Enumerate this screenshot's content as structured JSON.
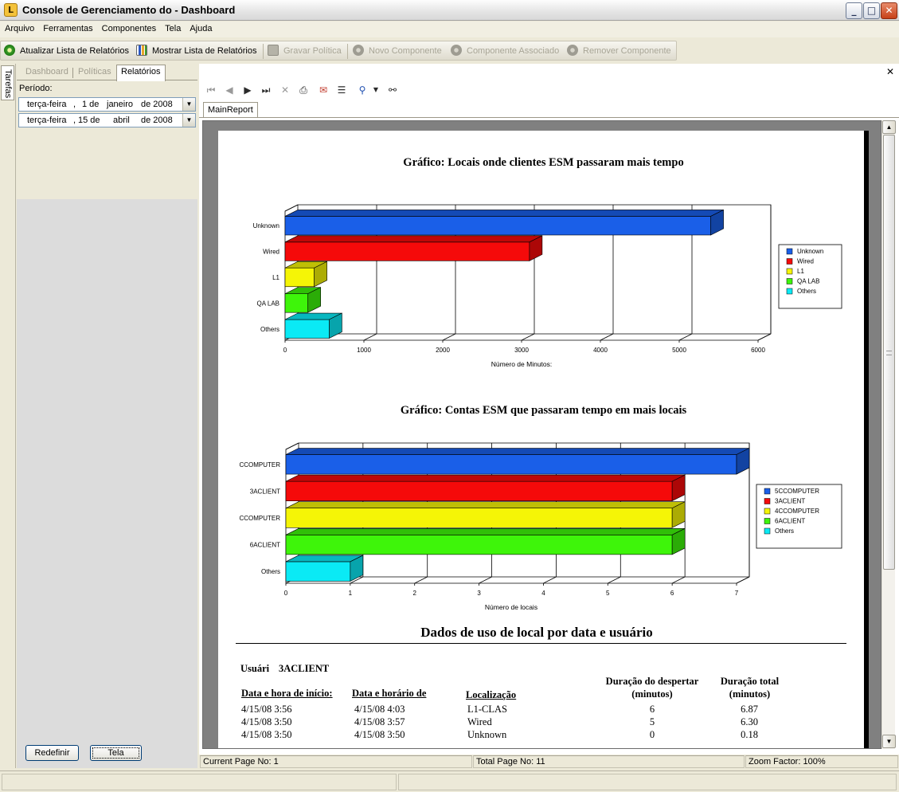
{
  "window": {
    "title": "Console de Gerenciamento do  - Dashboard",
    "app_icon_letter": "L",
    "controls": {
      "minimize": "_",
      "maximize": "□",
      "close": "✕"
    }
  },
  "menu": [
    "Arquivo",
    "Ferramentas",
    "Componentes",
    "Tela",
    "Ajuda"
  ],
  "toolbar": {
    "items": [
      {
        "label": "Atualizar Lista de Relatórios",
        "icon": "refresh-icon",
        "enabled": true
      },
      {
        "label": "Mostrar Lista de Relatórios",
        "icon": "chart-list-icon",
        "enabled": true
      },
      {
        "label": "Gravar Política",
        "icon": "save-disk-icon",
        "enabled": false
      },
      {
        "label": "Novo Componente",
        "icon": "gears-icon",
        "enabled": false
      },
      {
        "label": "Componente Associado",
        "icon": "gears-icon",
        "enabled": false
      },
      {
        "label": "Remover Componente",
        "icon": "gears-icon",
        "enabled": false
      }
    ]
  },
  "side_tab": "Tarefas",
  "left_panel": {
    "tabs": [
      {
        "label": "Dashboard",
        "active": false
      },
      {
        "label": "Políticas",
        "active": false
      },
      {
        "label": "Relatórios",
        "active": true
      }
    ],
    "period_label": "Período:",
    "date_from": {
      "weekday": "terça-feira",
      "day": "1 de",
      "month": "janeiro",
      "year": "de 2008"
    },
    "date_to": {
      "weekday": "terça-feira",
      "day": "15 de",
      "month": "abril",
      "year": "de 2008"
    },
    "reset_button": "Redefinir",
    "view_button": "Tela"
  },
  "viewer": {
    "close": "✕",
    "report_tab": "MainReport",
    "toolbar_icons": [
      "first-page-icon",
      "prev-page-icon",
      "next-page-icon",
      "last-page-icon",
      "stop-icon",
      "print-icon",
      "export-icon",
      "group-tree-icon",
      "zoom-icon",
      "find-icon"
    ],
    "status": {
      "current_page": "Current Page No: 1",
      "total_page": "Total Page No: 11",
      "zoom": "Zoom Factor: 100%"
    }
  },
  "colors": {
    "blue": "#1a5fe8",
    "red": "#f50a0a",
    "yellow": "#f5f506",
    "green": "#3ef50a",
    "cyan": "#0aeaf5"
  },
  "chart_data": [
    {
      "type": "bar",
      "orientation": "horizontal",
      "title": "Gráfico: Locais onde clientes ESM passaram mais tempo",
      "xlabel": "Número de Minutos:",
      "categories": [
        "Unknown",
        "Wired",
        "L1",
        "QA LAB",
        "Others"
      ],
      "values": [
        5400,
        3100,
        370,
        290,
        560
      ],
      "xlim": [
        0,
        6000
      ],
      "xticks": [
        "0",
        "1000",
        "2000",
        "3000",
        "4000",
        "5000",
        "6000"
      ],
      "legend": [
        "Unknown",
        "Wired",
        "L1",
        "QA LAB",
        "Others"
      ],
      "legend_position": "right",
      "grid": true
    },
    {
      "type": "bar",
      "orientation": "horizontal",
      "title": "Gráfico: Contas ESM que passaram tempo em mais locais",
      "xlabel": "Número de locais",
      "categories": [
        "CCOMPUTER",
        "3ACLIENT",
        "CCOMPUTER",
        "6ACLIENT",
        "Others"
      ],
      "values": [
        7,
        6,
        6,
        6,
        1
      ],
      "xlim": [
        0,
        7
      ],
      "xticks": [
        "0",
        "1",
        "2",
        "3",
        "4",
        "5",
        "6",
        "7"
      ],
      "legend": [
        "5CCOMPUTER",
        "3ACLIENT",
        "4CCOMPUTER",
        "6ACLIENT",
        "Others"
      ],
      "legend_position": "right",
      "grid": true
    }
  ],
  "report": {
    "section_title": "Dados de uso de local por data e usuário",
    "user_label": "Usuári",
    "user_value": "3ACLIENT",
    "columns": {
      "start": "Data e hora de início:",
      "end": "Data e horário de",
      "location": "Localização",
      "wake_line1": "Duração do despertar",
      "wake_line2": "(minutos)",
      "total_line1": "Duração total",
      "total_line2": "(minutos)"
    },
    "rows": [
      {
        "start": "4/15/08   3:56",
        "end": "4/15/08   4:03",
        "location": "L1-CLAS",
        "wake": "6",
        "total": "6.87"
      },
      {
        "start": "4/15/08   3:50",
        "end": "4/15/08   3:57",
        "location": "Wired",
        "wake": "5",
        "total": "6.30"
      },
      {
        "start": "4/15/08   3:50",
        "end": "4/15/08   3:50",
        "location": "Unknown",
        "wake": "0",
        "total": "0.18"
      }
    ]
  }
}
